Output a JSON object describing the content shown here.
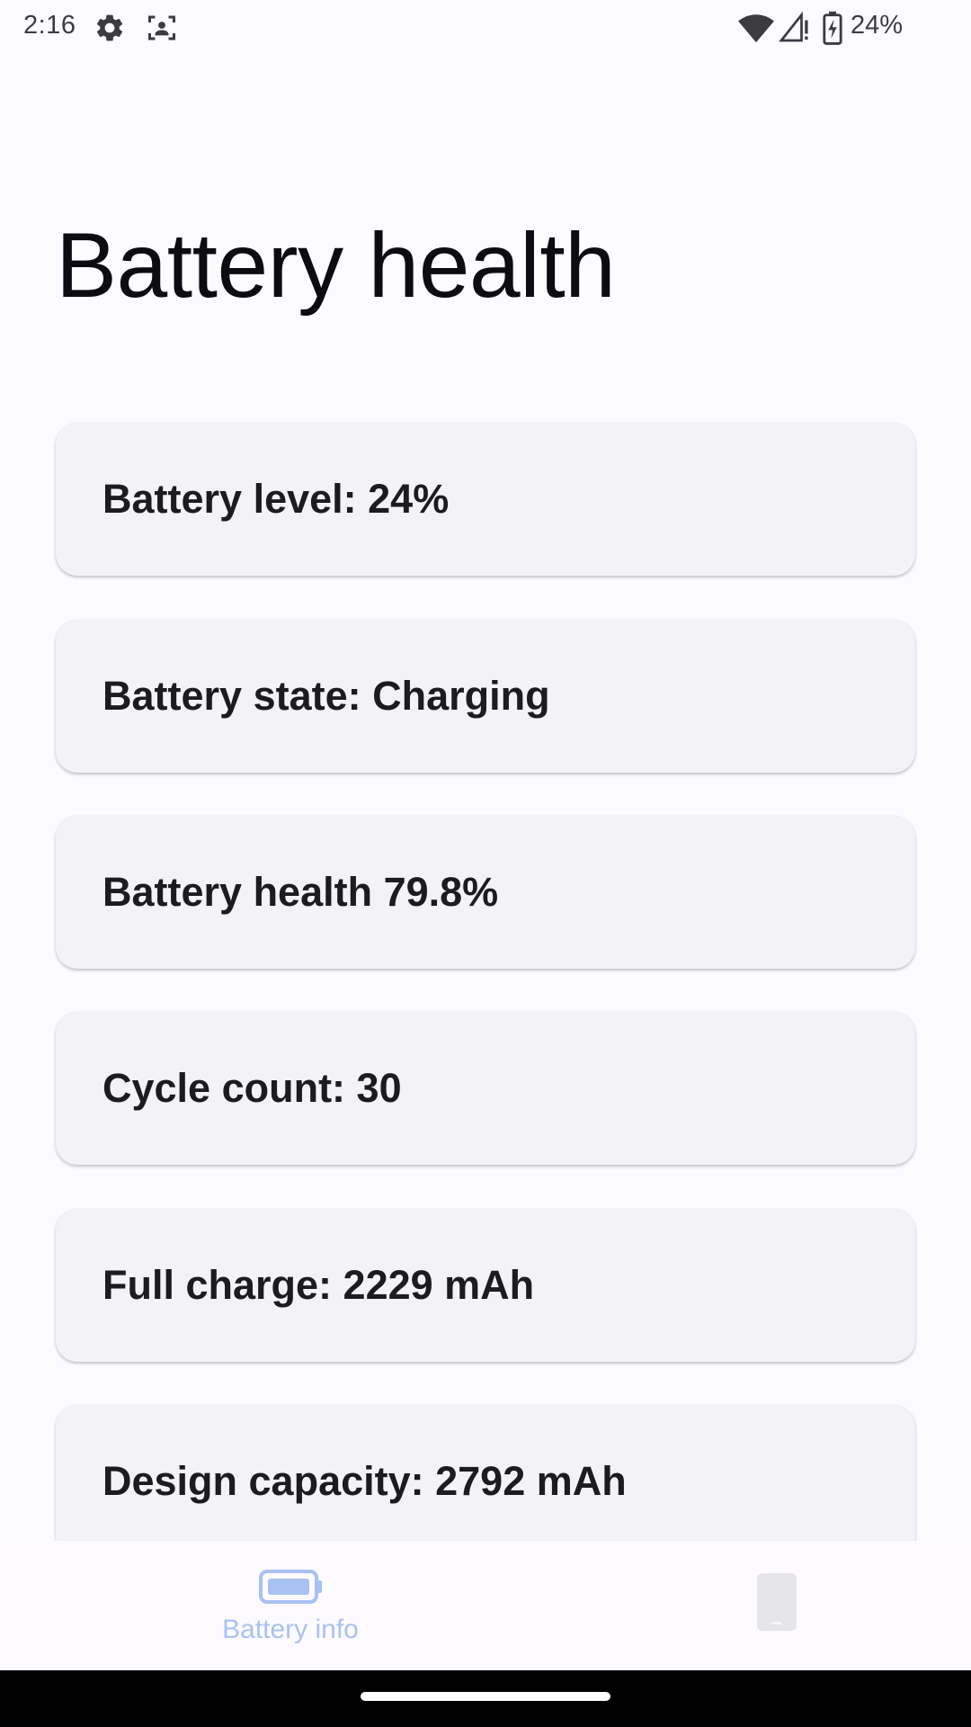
{
  "status_bar": {
    "time": "2:16",
    "battery_percent": "24%",
    "icons": [
      "gear-icon",
      "face-scan-icon",
      "wifi-icon",
      "signal-icon",
      "battery-charging-icon"
    ]
  },
  "page": {
    "title": "Battery health"
  },
  "cards": [
    {
      "text": "Battery level: 24%"
    },
    {
      "text": "Battery state: Charging"
    },
    {
      "text": "Battery health 79.8%"
    },
    {
      "text": "Cycle count: 30"
    },
    {
      "text": "Full charge: 2229 mAh"
    },
    {
      "text": "Design capacity: 2792 mAh"
    }
  ],
  "bottom_nav": {
    "items": [
      {
        "label": "Battery info",
        "icon": "battery-icon",
        "selected": true
      },
      {
        "label": "",
        "icon": "phone-icon",
        "selected": false
      }
    ],
    "accent_color": "#a9c1f3"
  },
  "colors": {
    "background": "#fcfbfe",
    "card": "#f3f2f7",
    "text": "#1d1b20"
  }
}
